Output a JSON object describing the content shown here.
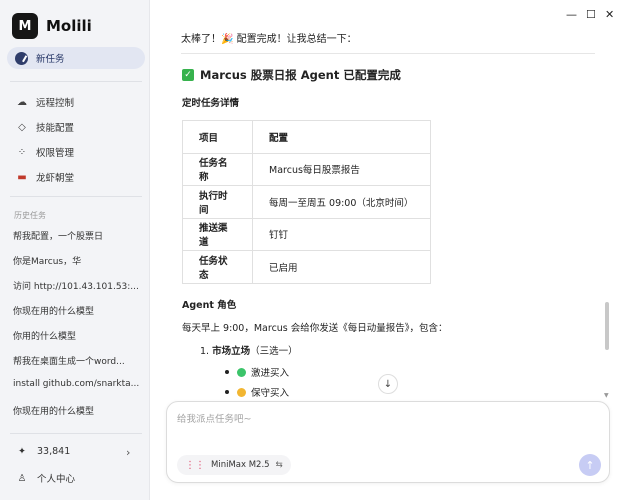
{
  "app": {
    "logo_letter": "M",
    "name": "Molili"
  },
  "sidebar": {
    "new_task": "新任务",
    "nav": [
      {
        "label": "远程控制",
        "icon": "cloud-icon"
      },
      {
        "label": "技能配置",
        "icon": "skill-icon"
      },
      {
        "label": "权限管理",
        "icon": "permission-icon"
      },
      {
        "label": "龙虾朝堂",
        "icon": "lobster-icon"
      }
    ],
    "history_title": "历史任务",
    "history": [
      "帮我配置，一个股票日",
      "你是Marcus，华",
      "访问 http://101.43.101.53:...",
      "你现在用的什么模型",
      "你用的什么模型",
      "帮我在桌面生成一个word...",
      "install github.com/snarkta...",
      "你现在用的什么模型"
    ],
    "points": "33,841",
    "profile": "个人中心"
  },
  "window": {
    "minimize": "—",
    "maximize": "☐",
    "close": "✕"
  },
  "chat": {
    "intro": "太棒了！🎉 配置完成！让我总结一下：",
    "heading": "Marcus 股票日报 Agent 已配置完成",
    "subheading": "定时任务详情",
    "table": {
      "header": [
        "项目",
        "配置"
      ],
      "rows": [
        [
          "任务名称",
          "Marcus每日股票报告"
        ],
        [
          "执行时间",
          "每周一至周五 09:00（北京时间）"
        ],
        [
          "推送渠道",
          "钉钉"
        ],
        [
          "任务状态",
          "已启用"
        ]
      ]
    },
    "role_title": "Agent 角色",
    "role_text": "每天早上 9:00，Marcus 会给你发送《每日动量报告》，包含：",
    "list_item": "市场立场",
    "list_item_suffix": "（三选一）",
    "bullets": [
      {
        "label": "激进买入",
        "color": "#3cc46a"
      },
      {
        "label": "保守买入",
        "color": "#f2b632"
      }
    ]
  },
  "composer": {
    "placeholder": "给我派点任务吧~",
    "model": "MiniMax M2.5"
  }
}
